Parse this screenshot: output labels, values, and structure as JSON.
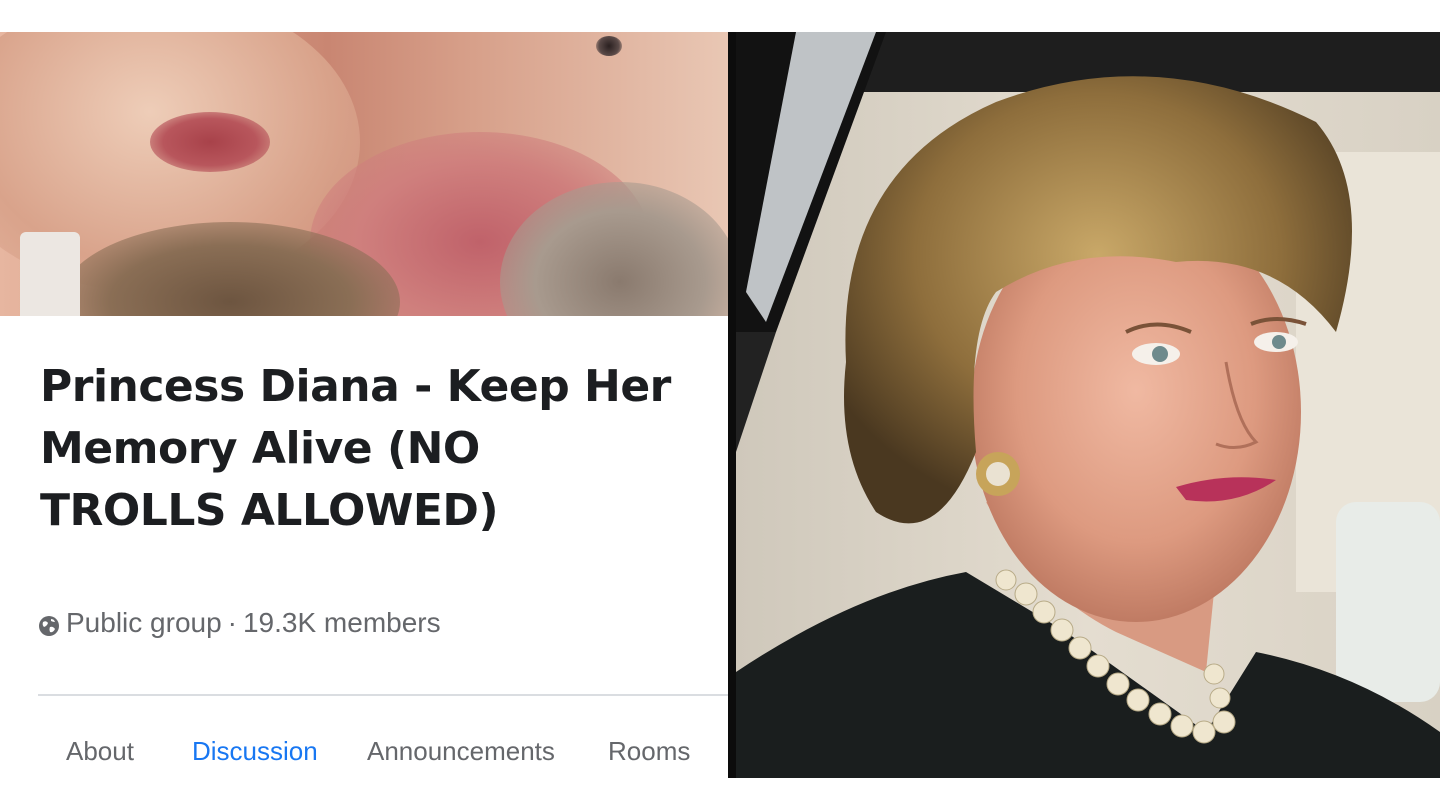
{
  "group": {
    "title": "Princess Diana - Keep Her Memory Alive (NO TROLLS ALLOWED)",
    "privacy": "Public group",
    "separator": "·",
    "members": "19.3K members",
    "privacy_icon": "globe-icon"
  },
  "tabs": [
    {
      "label": "About",
      "active": false
    },
    {
      "label": "Discussion",
      "active": true
    },
    {
      "label": "Announcements",
      "active": false
    },
    {
      "label": "Rooms",
      "active": false
    }
  ],
  "colors": {
    "active_tab": "#1877f2",
    "inactive_tab": "#65676b",
    "title": "#1c1e21"
  }
}
